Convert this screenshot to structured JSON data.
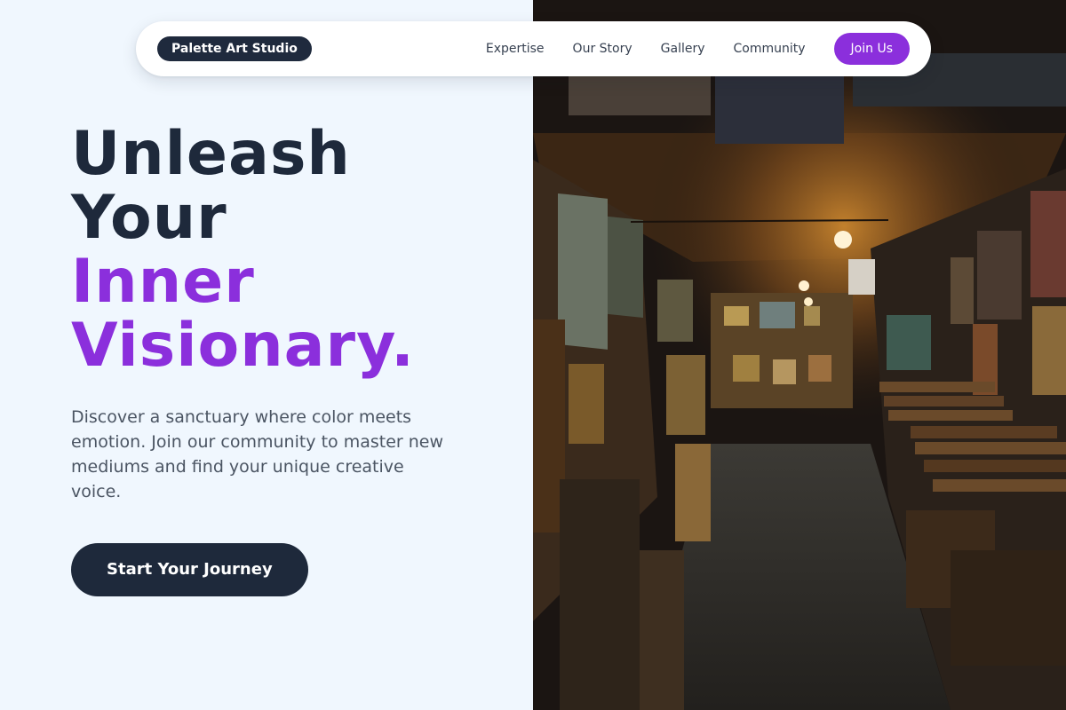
{
  "nav": {
    "brand": "Palette Art Studio",
    "links": [
      "Expertise",
      "Our Story",
      "Gallery",
      "Community"
    ],
    "join_label": "Join Us",
    "accent_color": "#8b2fdc"
  },
  "hero": {
    "headline_line1": "Unleash",
    "headline_line2": "Your",
    "headline_line3": "Inner",
    "headline_line4": "Visionary.",
    "description": "Discover a sanctuary where color meets emotion. Join our community to master new mediums and find your unique creative voice.",
    "cta_label": "Start Your Journey"
  },
  "colors": {
    "background": "#f0f7fe",
    "dark": "#1e293b",
    "accent": "#8b2fdc"
  }
}
